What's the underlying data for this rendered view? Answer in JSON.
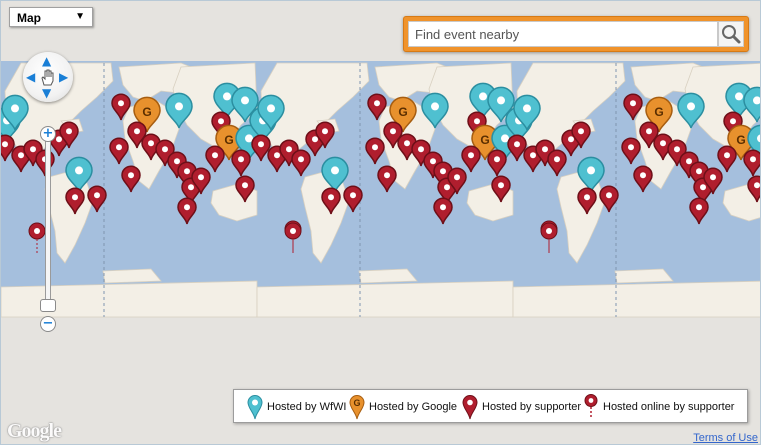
{
  "map_type": {
    "label": "Map",
    "arrow": "▼"
  },
  "search": {
    "placeholder": "Find event nearby",
    "icon": "search-icon"
  },
  "controls": {
    "pan": {
      "up": "▲",
      "down": "▼",
      "left": "◀",
      "right": "▶",
      "center_icon": "hand-icon"
    },
    "zoom": {
      "in": "+",
      "out": "−"
    }
  },
  "legend": [
    {
      "label": "Hosted by WfWI",
      "icon": "wfwi-marker-icon",
      "color": "#4fc0d0"
    },
    {
      "label": "Hosted by Google",
      "icon": "google-marker-icon",
      "color": "#e8912d"
    },
    {
      "label": "Hosted by supporter",
      "icon": "supporter-marker-icon",
      "color": "#b01e2e"
    },
    {
      "label": "Hosted online by supporter",
      "icon": "online-supporter-marker-icon",
      "color": "#b01e2e"
    }
  ],
  "attribution": {
    "logo": "Google",
    "terms": "Terms of Use"
  },
  "colors": {
    "ocean": "#a5bfdd",
    "land": "#f3efe6",
    "background": "#e5e3df",
    "accent": "#f0932b"
  }
}
